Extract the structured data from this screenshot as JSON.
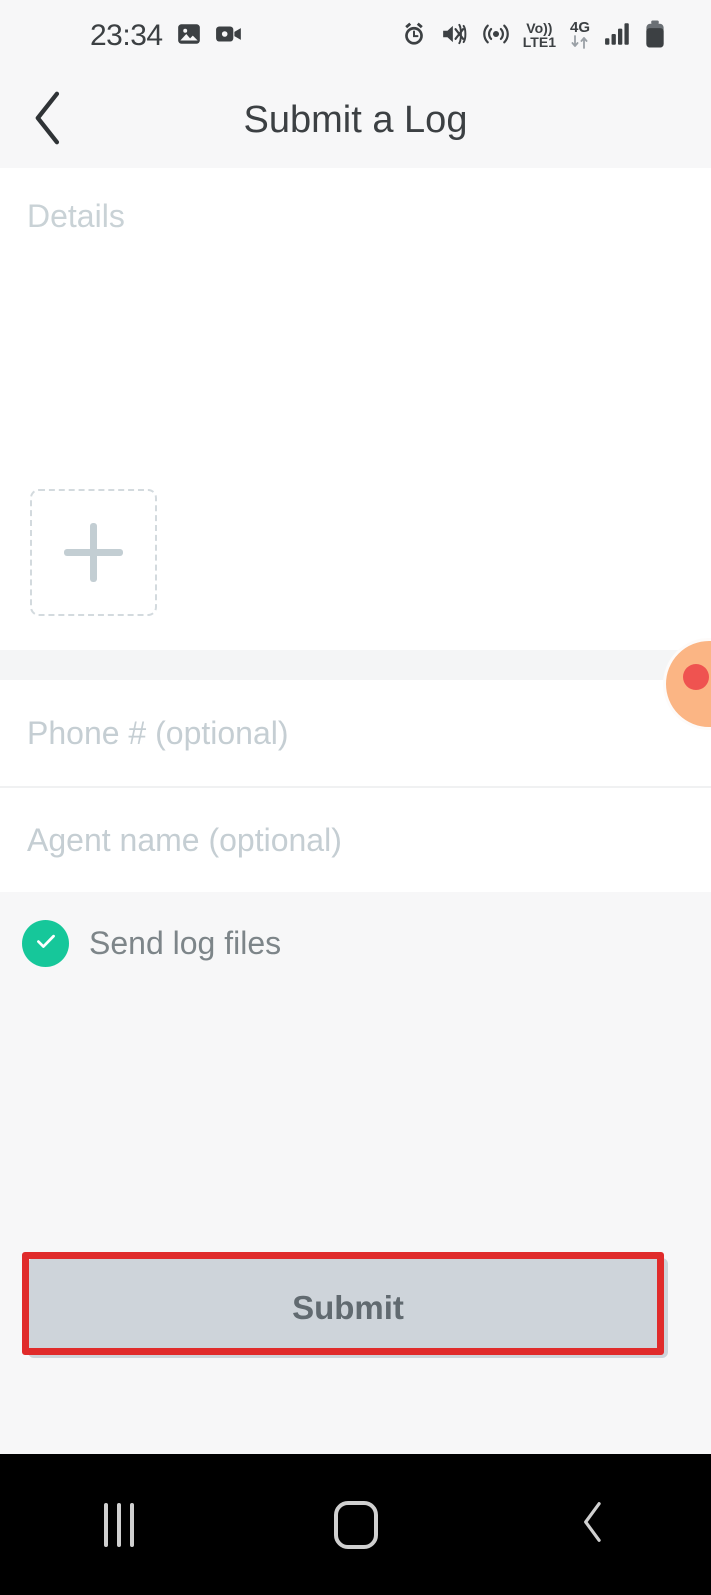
{
  "status_bar": {
    "time": "23:34",
    "left_icons": [
      "image-icon",
      "video-camera-icon"
    ],
    "right_icons": [
      "alarm-icon",
      "mute-vibrate-icon",
      "hotspot-icon",
      "signal-bars-icon",
      "battery-icon"
    ],
    "volte_line1": "Vo))",
    "volte_line2": "LTE1",
    "network_type": "4G",
    "data_arrows": "↓↑"
  },
  "app_bar": {
    "back_icon": "chevron-left-icon",
    "title": "Submit a Log"
  },
  "form": {
    "details_placeholder": "Details",
    "details_value": "",
    "attachment": {
      "icon": "plus-icon",
      "label": ""
    },
    "phone_placeholder": "Phone #  (optional)",
    "phone_value": "",
    "agent_placeholder": "Agent name  (optional)",
    "agent_value": "",
    "send_logs": {
      "label": "Send log files",
      "checked": true,
      "icon": "check-icon"
    }
  },
  "submit": {
    "label": "Submit",
    "enabled": false
  },
  "annotation": {
    "highlight_color": "#e02b2b",
    "target": "submit-button"
  },
  "overlay": {
    "touch_indicator": "touch-point-bubble"
  },
  "nav_bar": {
    "recents_icon": "recents-icon",
    "home_icon": "home-icon",
    "back_icon": "back-chevron-icon"
  },
  "colors": {
    "accent_green": "#16c79a",
    "header_bg": "#f7f7f8",
    "card_bg": "#ffffff",
    "placeholder": "#c5ced3",
    "button_disabled": "#ced4da",
    "highlight_red": "#e02b2b"
  }
}
